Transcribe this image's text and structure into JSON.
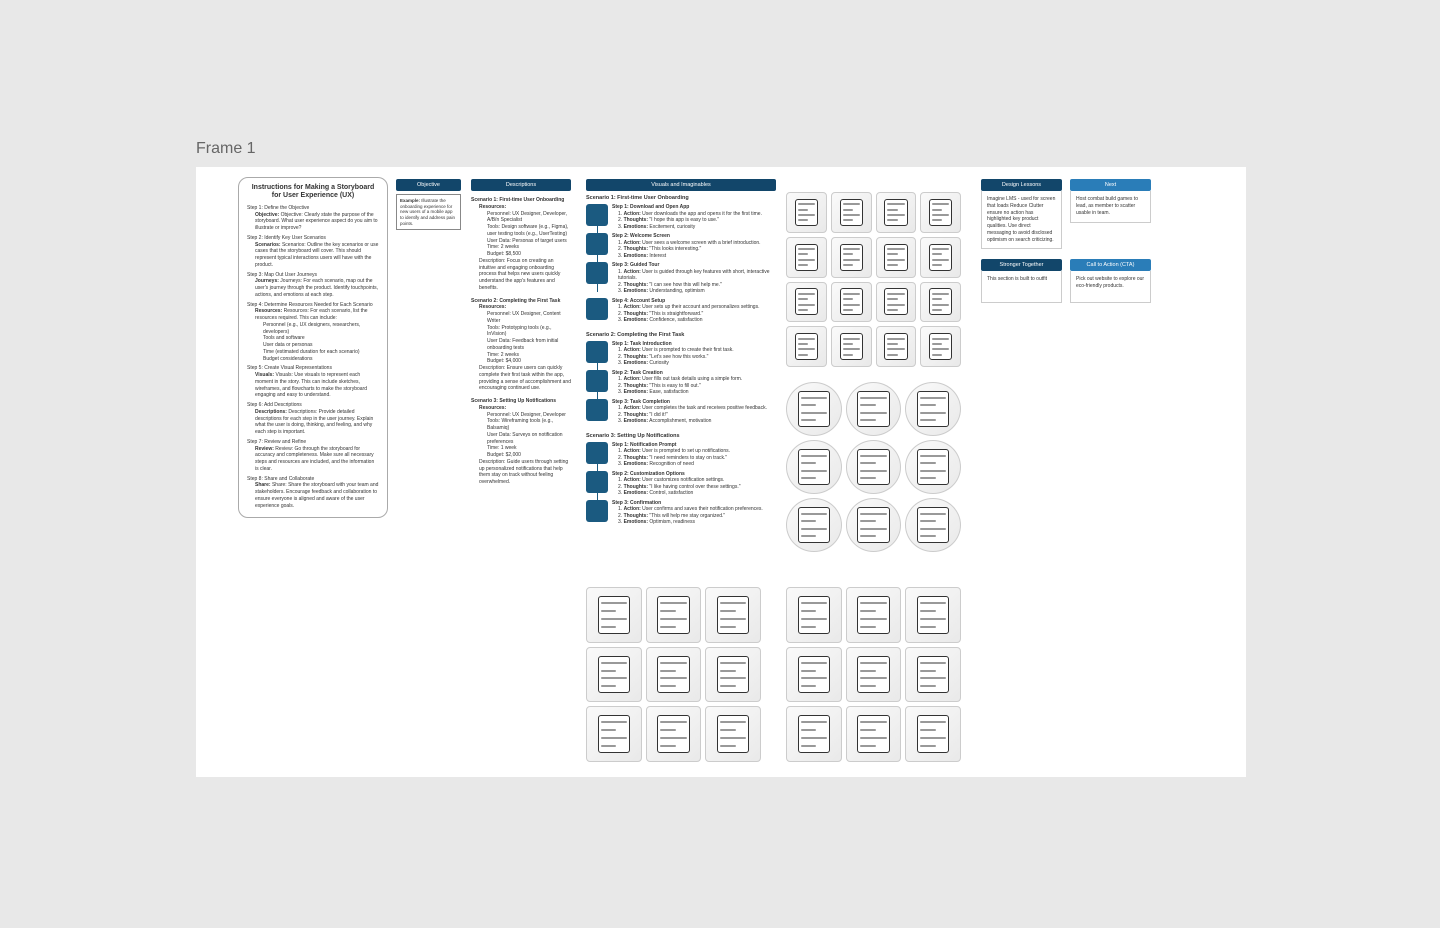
{
  "frame_title": "Frame 1",
  "instructions": {
    "title": "Instructions for Making a Storyboard for User Experience (UX)",
    "step1_h": "Step 1: Define the Objective",
    "step1_a": "Objective: Clearly state the purpose of the storyboard. What user experience aspect do you aim to illustrate or improve?",
    "step2_h": "Step 2: Identify Key User Scenarios",
    "step2_a": "Scenarios: Outline the key scenarios or use cases that the storyboard will cover. This should represent typical interactions users will have with the product.",
    "step3_h": "Step 3: Map Out User Journeys",
    "step3_a": "Journeys: For each scenario, map out the user's journey through the product. Identify touchpoints, actions, and emotions at each step.",
    "step4_h": "Step 4: Determine Resources Needed for Each Scenario",
    "step4_a": "Resources: For each scenario, list the resources required. This can include:",
    "step4_b1": "Personnel (e.g., UX designers, researchers, developers)",
    "step4_b2": "Tools and software",
    "step4_b3": "User data or personas",
    "step4_b4": "Time (estimated duration for each scenario)",
    "step4_b5": "Budget considerations",
    "step5_h": "Step 5: Create Visual Representations",
    "step5_a": "Visuals: Use visuals to represent each moment in the story. This can include sketches, wireframes, and flowcharts to make the storyboard engaging and easy to understand.",
    "step6_h": "Step 6: Add Descriptions",
    "step6_a": "Descriptions: Provide detailed descriptions for each step in the user journey. Explain what the user is doing, thinking, and feeling, and why each step is important.",
    "step7_h": "Step 7: Review and Refine",
    "step7_a": "Review: Go through the storyboard for accuracy and completeness. Make sure all necessary steps and resources are included, and the information is clear.",
    "step8_h": "Step 8: Share and Collaborate",
    "step8_a": "Share: Share the storyboard with your team and stakeholders. Encourage feedback and collaboration to ensure everyone is aligned and aware of the user experience goals."
  },
  "columns": {
    "objective": "Objective",
    "description": "Descriptions",
    "visuals": "Visuals and Imaginables",
    "design": "Design Lessons",
    "next": "Next",
    "stronger": "Stronger Together",
    "cta": "Call to Action (CTA)"
  },
  "objective_box": {
    "label": "Example:",
    "text": "Illustrate the onboarding experience for new users of a mobile app to identify and address pain points."
  },
  "descriptions": {
    "s1_h": "Scenario 1: First-time User Onboarding",
    "s2_h": "Scenario 2: Completing the First Task",
    "s3_h": "Scenario 3: Setting Up Notifications",
    "res_h": "Resources:",
    "s1_p": "Personnel: UX Designer, Developer, A/B/n Specialist",
    "s1_t": "Tools: Design software (e.g., Figma), user testing tools (e.g., UserTesting)",
    "s1_u": "User Data: Personas of target users",
    "s1_time": "Time: 2 weeks",
    "s1_budget": "Budget: $8,500",
    "s1_desc": "Description: Focus on creating an intuitive and engaging onboarding process that helps new users quickly understand the app's features and benefits.",
    "s2_p": "Personnel: UX Designer, Content Writer",
    "s2_t": "Tools: Prototyping tools (e.g., InVision)",
    "s2_u": "User Data: Feedback from initial onboarding tests",
    "s2_time": "Time: 2 weeks",
    "s2_budget": "Budget: $4,000",
    "s2_desc": "Description: Ensure users can quickly complete their first task within the app, providing a sense of accomplishment and encouraging continued use.",
    "s3_p": "Personnel: UX Designer, Developer",
    "s3_t": "Tools: Wireframing tools (e.g., Balsamiq)",
    "s3_u": "User Data: Surveys on notification preferences",
    "s3_time": "Time: 1 week",
    "s3_budget": "Budget: $2,000",
    "s3_desc": "Description: Guide users through setting up personalized notifications that help them stay on track without feeling overwhelmed."
  },
  "steps": {
    "sc1_h": "Scenario 1: First-time User Onboarding",
    "sc1_1_h": "Step 1: Download and Open App",
    "sc1_1_a": "Action: User downloads the app and opens it for the first time.",
    "sc1_1_t": "Thoughts: \"I hope this app is easy to use.\"",
    "sc1_1_e": "Emotions: Excitement, curiosity",
    "sc1_2_h": "Step 2: Welcome Screen",
    "sc1_2_a": "Action: User sees a welcome screen with a brief introduction.",
    "sc1_2_t": "Thoughts: \"This looks interesting.\"",
    "sc1_2_e": "Emotions: Interest",
    "sc1_3_h": "Step 3: Guided Tour",
    "sc1_3_a": "Action: User is guided through key features with short, interactive tutorials.",
    "sc1_3_t": "Thoughts: \"I can see how this will help me.\"",
    "sc1_3_e": "Emotions: Understanding, optimism",
    "sc1_4_h": "Step 4: Account Setup",
    "sc1_4_a": "Action: User sets up their account and personalizes settings.",
    "sc1_4_t": "Thoughts: \"This is straightforward.\"",
    "sc1_4_e": "Emotions: Confidence, satisfaction",
    "sc2_h": "Scenario 2: Completing the First Task",
    "sc2_1_h": "Step 1: Task Introduction",
    "sc2_1_a": "Action: User is prompted to create their first task.",
    "sc2_1_t": "Thoughts: \"Let's see how this works.\"",
    "sc2_1_e": "Emotions: Curiosity",
    "sc2_2_h": "Step 2: Task Creation",
    "sc2_2_a": "Action: User fills out task details using a simple form.",
    "sc2_2_t": "Thoughts: \"This is easy to fill out.\"",
    "sc2_2_e": "Emotions: Ease, satisfaction",
    "sc2_3_h": "Step 3: Task Completion",
    "sc2_3_a": "Action: User completes the task and receives positive feedback.",
    "sc2_3_t": "Thoughts: \"I did it!\"",
    "sc2_3_e": "Emotions: Accomplishment, motivation",
    "sc3_h": "Scenario 3: Setting Up Notifications",
    "sc3_1_h": "Step 1: Notification Prompt",
    "sc3_1_a": "Action: User is prompted to set up notifications.",
    "sc3_1_t": "Thoughts: \"I need reminders to stay on track.\"",
    "sc3_1_e": "Emotions: Recognition of need",
    "sc3_2_h": "Step 2: Customization Options",
    "sc3_2_a": "Action: User customizes notification settings.",
    "sc3_2_t": "Thoughts: \"I like having control over these settings.\"",
    "sc3_2_e": "Emotions: Control, satisfaction",
    "sc3_3_h": "Step 3: Confirmation",
    "sc3_3_a": "Action: User confirms and saves their notification preferences.",
    "sc3_3_t": "Thoughts: \"This will help me stay organized.\"",
    "sc3_3_e": "Emotions: Optimism, readiness"
  },
  "notes": {
    "design_body": "Imagine LMS - used for screen that loads Reduce Clutter ensure no action has highlighted key product qualities. Use direct messaging to avoid disclosed optimism on search criticizing.",
    "next_body": "Host combat build games to lead, as member to scatter usable in team.",
    "stronger_body": "This section is built to outfit",
    "cta_body": "Pick out website to explore our eco-friendly products."
  }
}
